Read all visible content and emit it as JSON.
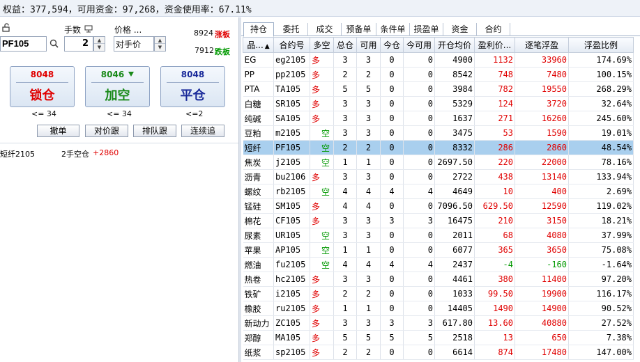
{
  "summary": "权益：377,594，可用资金：97,268，资金使用率：67.11%",
  "order_panel": {
    "qty_label": "手数",
    "price_label": "价格 ...",
    "contract_code": "PF105",
    "quantity": "2",
    "price_mode": "对手价",
    "limit_up": "8924",
    "limit_up_label": "涨板",
    "limit_down": "7912",
    "limit_down_label": "跌板",
    "buttons": [
      {
        "price": "8048",
        "label": "锁仓",
        "limit": "<= 34"
      },
      {
        "price": "8046",
        "label": "加空",
        "limit": "<= 34"
      },
      {
        "price": "8048",
        "label": "平仓",
        "limit": "<=2"
      }
    ],
    "small_buttons": [
      "撤单",
      "对价跟",
      "排队跟",
      "连续追"
    ],
    "position_info": {
      "name": "短纤2105",
      "desc": "2手空仓",
      "pnl": "+2860"
    }
  },
  "tabs": [
    "持仓",
    "委托",
    "成交",
    "预备单",
    "条件单",
    "损盈单",
    "资金",
    "合约"
  ],
  "active_tab": "持仓",
  "table": {
    "headers": [
      "品...",
      "合约号",
      "多空",
      "总仓",
      "可用",
      "今仓",
      "今可用",
      "开仓均价",
      "盈利价...",
      "逐笔浮盈",
      "浮盈比例"
    ],
    "sort_indicator": "▲",
    "rows": [
      {
        "name": "EG",
        "code": "eg2105",
        "dir": "多",
        "total": "3",
        "avail": "3",
        "today": "0",
        "today_avail": "0",
        "open": "4900",
        "profit_pt": "1132",
        "float_pnl": "33960",
        "ratio": "174.69%"
      },
      {
        "name": "PP",
        "code": "pp2105",
        "dir": "多",
        "total": "2",
        "avail": "2",
        "today": "0",
        "today_avail": "0",
        "open": "8542",
        "profit_pt": "748",
        "float_pnl": "7480",
        "ratio": "100.15%"
      },
      {
        "name": "PTA",
        "code": "TA105",
        "dir": "多",
        "total": "5",
        "avail": "5",
        "today": "0",
        "today_avail": "0",
        "open": "3984",
        "profit_pt": "782",
        "float_pnl": "19550",
        "ratio": "268.29%"
      },
      {
        "name": "白糖",
        "code": "SR105",
        "dir": "多",
        "total": "3",
        "avail": "3",
        "today": "0",
        "today_avail": "0",
        "open": "5329",
        "profit_pt": "124",
        "float_pnl": "3720",
        "ratio": "32.64%"
      },
      {
        "name": "纯碱",
        "code": "SA105",
        "dir": "多",
        "total": "3",
        "avail": "3",
        "today": "0",
        "today_avail": "0",
        "open": "1637",
        "profit_pt": "271",
        "float_pnl": "16260",
        "ratio": "245.60%"
      },
      {
        "name": "豆粕",
        "code": "m2105",
        "dir": "空",
        "total": "3",
        "avail": "3",
        "today": "0",
        "today_avail": "0",
        "open": "3475",
        "profit_pt": "53",
        "float_pnl": "1590",
        "ratio": "19.01%"
      },
      {
        "name": "短纤",
        "code": "PF105",
        "dir": "空",
        "total": "2",
        "avail": "2",
        "today": "0",
        "today_avail": "0",
        "open": "8332",
        "profit_pt": "286",
        "float_pnl": "2860",
        "ratio": "48.54%"
      },
      {
        "name": "焦炭",
        "code": "j2105",
        "dir": "空",
        "total": "1",
        "avail": "1",
        "today": "0",
        "today_avail": "0",
        "open": "2697.50",
        "profit_pt": "220",
        "float_pnl": "22000",
        "ratio": "78.16%"
      },
      {
        "name": "沥青",
        "code": "bu2106",
        "dir": "多",
        "total": "3",
        "avail": "3",
        "today": "0",
        "today_avail": "0",
        "open": "2722",
        "profit_pt": "438",
        "float_pnl": "13140",
        "ratio": "133.94%"
      },
      {
        "name": "螺纹",
        "code": "rb2105",
        "dir": "空",
        "total": "4",
        "avail": "4",
        "today": "4",
        "today_avail": "4",
        "open": "4649",
        "profit_pt": "10",
        "float_pnl": "400",
        "ratio": "2.69%"
      },
      {
        "name": "锰硅",
        "code": "SM105",
        "dir": "多",
        "total": "4",
        "avail": "4",
        "today": "0",
        "today_avail": "0",
        "open": "7096.50",
        "profit_pt": "629.50",
        "float_pnl": "12590",
        "ratio": "119.02%"
      },
      {
        "name": "棉花",
        "code": "CF105",
        "dir": "多",
        "total": "3",
        "avail": "3",
        "today": "3",
        "today_avail": "3",
        "open": "16475",
        "profit_pt": "210",
        "float_pnl": "3150",
        "ratio": "18.21%"
      },
      {
        "name": "尿素",
        "code": "UR105",
        "dir": "空",
        "total": "3",
        "avail": "3",
        "today": "0",
        "today_avail": "0",
        "open": "2011",
        "profit_pt": "68",
        "float_pnl": "4080",
        "ratio": "37.99%"
      },
      {
        "name": "苹果",
        "code": "AP105",
        "dir": "空",
        "total": "1",
        "avail": "1",
        "today": "0",
        "today_avail": "0",
        "open": "6077",
        "profit_pt": "365",
        "float_pnl": "3650",
        "ratio": "75.08%"
      },
      {
        "name": "燃油",
        "code": "fu2105",
        "dir": "空",
        "total": "4",
        "avail": "4",
        "today": "4",
        "today_avail": "4",
        "open": "2437",
        "profit_pt": "-4",
        "float_pnl": "-160",
        "ratio": "-1.64%"
      },
      {
        "name": "热卷",
        "code": "hc2105",
        "dir": "多",
        "total": "3",
        "avail": "3",
        "today": "0",
        "today_avail": "0",
        "open": "4461",
        "profit_pt": "380",
        "float_pnl": "11400",
        "ratio": "97.20%"
      },
      {
        "name": "铁矿",
        "code": "i2105",
        "dir": "多",
        "total": "2",
        "avail": "2",
        "today": "0",
        "today_avail": "0",
        "open": "1033",
        "profit_pt": "99.50",
        "float_pnl": "19900",
        "ratio": "116.17%"
      },
      {
        "name": "橡胶",
        "code": "ru2105",
        "dir": "多",
        "total": "1",
        "avail": "1",
        "today": "0",
        "today_avail": "0",
        "open": "14405",
        "profit_pt": "1490",
        "float_pnl": "14900",
        "ratio": "90.52%"
      },
      {
        "name": "新动力",
        "code": "ZC105",
        "dir": "多",
        "total": "3",
        "avail": "3",
        "today": "3",
        "today_avail": "3",
        "open": "617.80",
        "profit_pt": "13.60",
        "float_pnl": "40880",
        "ratio": "27.52%"
      },
      {
        "name": "郑醇",
        "code": "MA105",
        "dir": "多",
        "total": "5",
        "avail": "5",
        "today": "5",
        "today_avail": "5",
        "open": "2518",
        "profit_pt": "13",
        "float_pnl": "650",
        "ratio": "7.38%"
      },
      {
        "name": "纸浆",
        "code": "sp2105",
        "dir": "多",
        "total": "2",
        "avail": "2",
        "today": "0",
        "today_avail": "0",
        "open": "6614",
        "profit_pt": "874",
        "float_pnl": "17480",
        "ratio": "147.00%"
      }
    ]
  },
  "colors": {
    "profit": "#e00000",
    "loss": "#009900",
    "long": "#e00000",
    "short": "#009900",
    "selected_row": "#a9cfee"
  }
}
